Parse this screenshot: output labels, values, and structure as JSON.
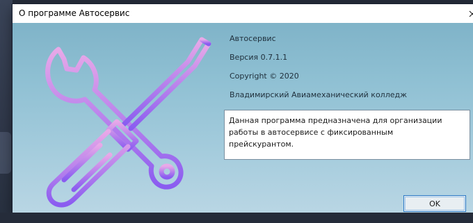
{
  "window": {
    "title": "О программе Автосервис",
    "close_icon": "close-icon"
  },
  "about": {
    "product_name": "Автосервис",
    "version": "Версия 0.7.1.1",
    "copyright": "Copyright ©  2020",
    "company": "Владимирский Авиамеханический колледж",
    "description": "Данная программа предназначена для организации\nработы в автосервисе с фиксированным\nпрейскурантом."
  },
  "buttons": {
    "ok_label": "OK"
  },
  "logo": {
    "icon": "wrench-screwdriver-icon",
    "color_top": "#e8a9e8",
    "color_bottom": "#8a5cf0"
  },
  "colors": {
    "background_top": "#7fb3c8",
    "background_bottom": "#b9d6e4",
    "accent_border": "#2a78c6"
  }
}
